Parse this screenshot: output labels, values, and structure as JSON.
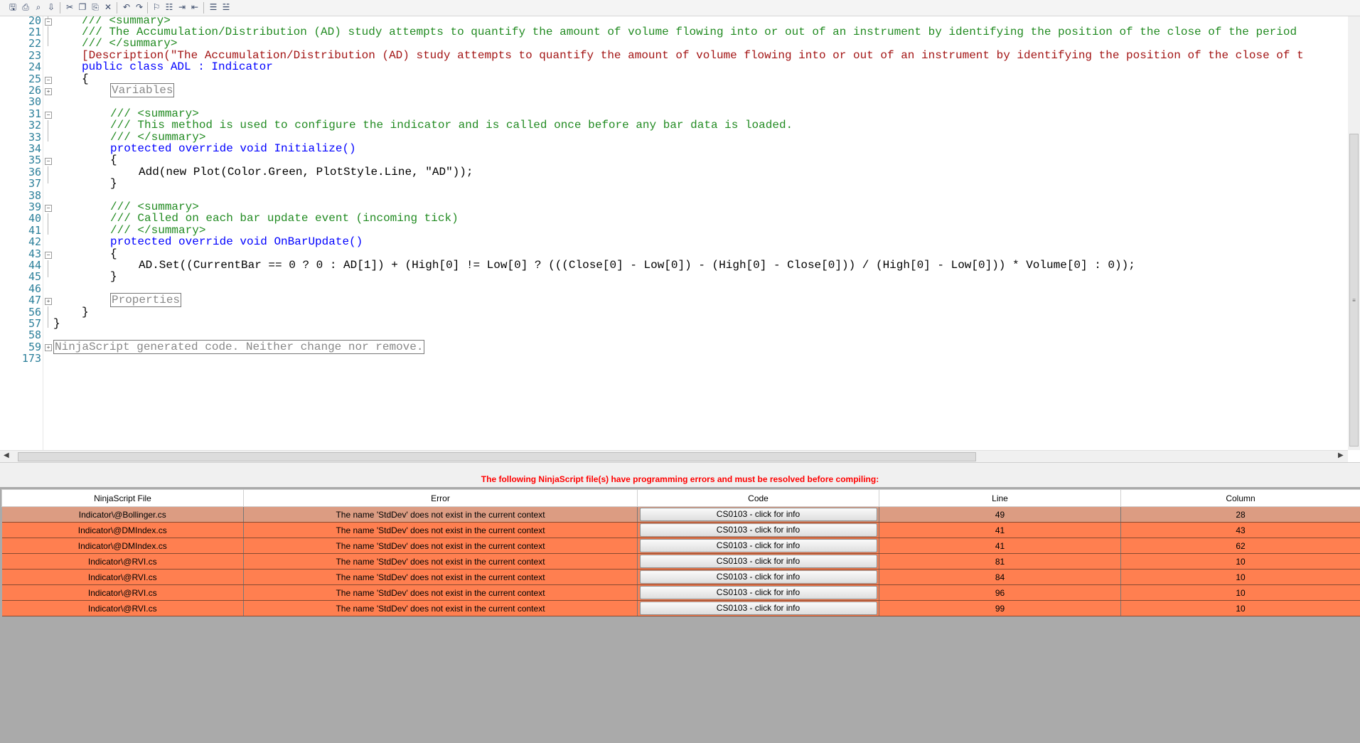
{
  "toolbar": {
    "icons": [
      "save-icon",
      "print-icon",
      "print-preview-icon",
      "export-icon",
      "cut-icon",
      "copy-icon",
      "paste-icon",
      "delete-icon",
      "undo-icon",
      "redo-icon",
      "find-icon",
      "find-replace-icon",
      "indent-icon",
      "outdent-icon",
      "comment-icon",
      "uncomment-icon"
    ]
  },
  "editor": {
    "lines": [
      {
        "n": "20",
        "text": "/// <summary>"
      },
      {
        "n": "21",
        "text": "/// The Accumulation/Distribution (AD) study attempts to quantify the amount of volume flowing into or out of an instrument by identifying the position of the close of the period"
      },
      {
        "n": "22",
        "text": "/// </summary>"
      },
      {
        "n": "23",
        "text": "[Description(\"The Accumulation/Distribution (AD) study attempts to quantify the amount of volume flowing into or out of an instrument by identifying the position of the close of t"
      },
      {
        "n": "24",
        "text": "public class ADL : Indicator"
      },
      {
        "n": "25",
        "text": "{"
      },
      {
        "n": "26",
        "text": "Variables"
      },
      {
        "n": "30",
        "text": ""
      },
      {
        "n": "31",
        "text": "/// <summary>"
      },
      {
        "n": "32",
        "text": "/// This method is used to configure the indicator and is called once before any bar data is loaded."
      },
      {
        "n": "33",
        "text": "/// </summary>"
      },
      {
        "n": "34",
        "text": "protected override void Initialize()"
      },
      {
        "n": "35",
        "text": "{"
      },
      {
        "n": "36",
        "text": "Add(new Plot(Color.Green, PlotStyle.Line, \"AD\"));"
      },
      {
        "n": "37",
        "text": "}"
      },
      {
        "n": "38",
        "text": ""
      },
      {
        "n": "39",
        "text": "/// <summary>"
      },
      {
        "n": "40",
        "text": "/// Called on each bar update event (incoming tick)"
      },
      {
        "n": "41",
        "text": "/// </summary>"
      },
      {
        "n": "42",
        "text": "protected override void OnBarUpdate()"
      },
      {
        "n": "43",
        "text": "{"
      },
      {
        "n": "44",
        "text": "AD.Set((CurrentBar == 0 ? 0 : AD[1]) + (High[0] != Low[0] ? (((Close[0] - Low[0]) - (High[0] - Close[0])) / (High[0] - Low[0])) * Volume[0] : 0));"
      },
      {
        "n": "45",
        "text": "}"
      },
      {
        "n": "46",
        "text": ""
      },
      {
        "n": "47",
        "text": "Properties"
      },
      {
        "n": "56",
        "text": "}"
      },
      {
        "n": "57",
        "text": "}"
      },
      {
        "n": "58",
        "text": ""
      },
      {
        "n": "59",
        "text": "NinjaScript generated code. Neither change nor remove."
      },
      {
        "n": "173",
        "text": ""
      }
    ]
  },
  "errors": {
    "title": "The following NinjaScript file(s) have programming errors and must be resolved before compiling:",
    "columns": [
      "NinjaScript File",
      "Error",
      "Code",
      "Line",
      "Column"
    ],
    "rows": [
      {
        "file": "Indicator\\@Bollinger.cs",
        "error": "The name 'StdDev' does not exist in the current context",
        "code": "CS0103 - click for info",
        "line": "49",
        "column": "28"
      },
      {
        "file": "Indicator\\@DMIndex.cs",
        "error": "The name 'StdDev' does not exist in the current context",
        "code": "CS0103 - click for info",
        "line": "41",
        "column": "43"
      },
      {
        "file": "Indicator\\@DMIndex.cs",
        "error": "The name 'StdDev' does not exist in the current context",
        "code": "CS0103 - click for info",
        "line": "41",
        "column": "62"
      },
      {
        "file": "Indicator\\@RVI.cs",
        "error": "The name 'StdDev' does not exist in the current context",
        "code": "CS0103 - click for info",
        "line": "81",
        "column": "10"
      },
      {
        "file": "Indicator\\@RVI.cs",
        "error": "The name 'StdDev' does not exist in the current context",
        "code": "CS0103 - click for info",
        "line": "84",
        "column": "10"
      },
      {
        "file": "Indicator\\@RVI.cs",
        "error": "The name 'StdDev' does not exist in the current context",
        "code": "CS0103 - click for info",
        "line": "96",
        "column": "10"
      },
      {
        "file": "Indicator\\@RVI.cs",
        "error": "The name 'StdDev' does not exist in the current context",
        "code": "CS0103 - click for info",
        "line": "99",
        "column": "10"
      }
    ]
  }
}
